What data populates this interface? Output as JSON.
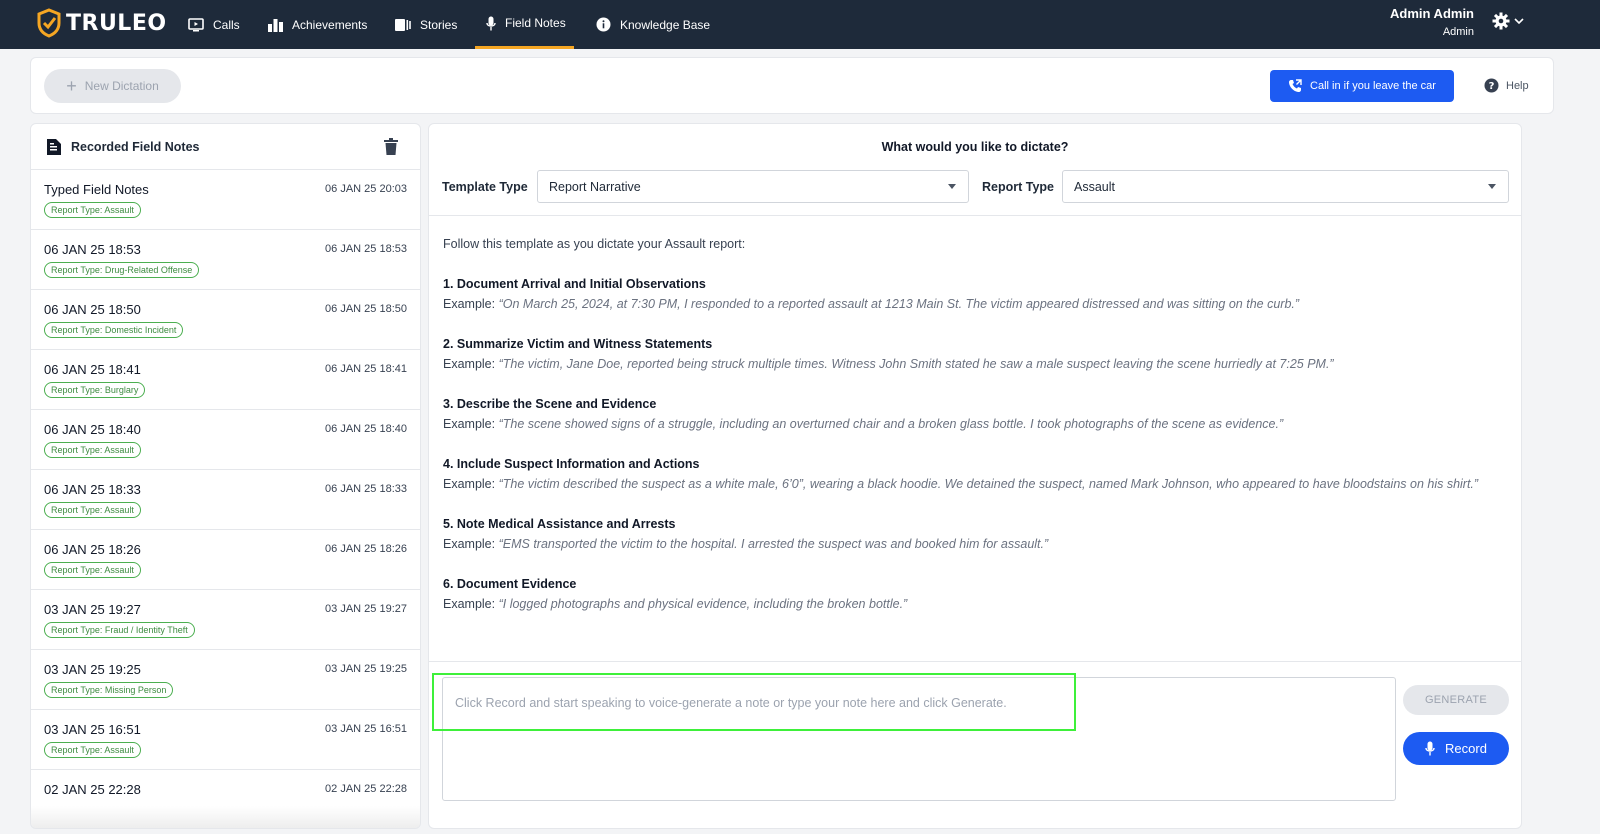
{
  "app": {
    "logo_text": "TRULEO",
    "accent": "#f5a623",
    "primary": "#1d5bf2"
  },
  "nav": {
    "items": [
      {
        "label": "Calls",
        "icon": "tv-play-icon"
      },
      {
        "label": "Achievements",
        "icon": "bar-chart-icon"
      },
      {
        "label": "Stories",
        "icon": "stories-icon"
      },
      {
        "label": "Field Notes",
        "icon": "microphone-icon",
        "active": true
      },
      {
        "label": "Knowledge Base",
        "icon": "info-icon"
      }
    ],
    "user": {
      "name": "Admin Admin",
      "role": "Admin"
    }
  },
  "toolbar": {
    "new_dictation": "New Dictation",
    "call_in": "Call in if you leave the car",
    "help": "Help"
  },
  "left": {
    "title": "Recorded Field Notes",
    "items": [
      {
        "title": "Typed Field Notes",
        "time": "06 JAN 25 20:03",
        "badge": "Report Type: Assault"
      },
      {
        "title": "06 JAN 25 18:53",
        "time": "06 JAN 25 18:53",
        "badge": "Report Type: Drug-Related Offense"
      },
      {
        "title": "06 JAN 25 18:50",
        "time": "06 JAN 25 18:50",
        "badge": "Report Type: Domestic Incident"
      },
      {
        "title": "06 JAN 25 18:41",
        "time": "06 JAN 25 18:41",
        "badge": "Report Type: Burglary"
      },
      {
        "title": "06 JAN 25 18:40",
        "time": "06 JAN 25 18:40",
        "badge": "Report Type: Assault"
      },
      {
        "title": "06 JAN 25 18:33",
        "time": "06 JAN 25 18:33",
        "badge": "Report Type: Assault"
      },
      {
        "title": "06 JAN 25 18:26",
        "time": "06 JAN 25 18:26",
        "badge": "Report Type: Assault"
      },
      {
        "title": "03 JAN 25 19:27",
        "time": "03 JAN 25 19:27",
        "badge": "Report Type: Fraud / Identity Theft"
      },
      {
        "title": "03 JAN 25 19:25",
        "time": "03 JAN 25 19:25",
        "badge": "Report Type: Missing Person"
      },
      {
        "title": "03 JAN 25 16:51",
        "time": "03 JAN 25 16:51",
        "badge": "Report Type: Assault"
      },
      {
        "title": "02 JAN 25 22:28",
        "time": "02 JAN 25 22:28",
        "badge": ""
      }
    ]
  },
  "right": {
    "question": "What would you like to dictate?",
    "template_label": "Template Type",
    "template_value": "Report Narrative",
    "report_label": "Report Type",
    "report_value": "Assault",
    "intro": "Follow this template as you dictate your Assault report:",
    "example_label": "Example:",
    "steps": [
      {
        "title": "1. Document Arrival and Initial Observations",
        "example": "“On March 25, 2024, at 7:30 PM, I responded to a reported assault at 1213 Main St. The victim appeared distressed and was sitting on the curb.”"
      },
      {
        "title": "2. Summarize Victim and Witness Statements",
        "example": "“The victim, Jane Doe, reported being struck multiple times. Witness John Smith stated he saw a male suspect leaving the scene hurriedly at 7:25 PM.”"
      },
      {
        "title": "3. Describe the Scene and Evidence",
        "example": "“The scene showed signs of a struggle, including an overturned chair and a broken glass bottle. I took photographs of the scene as evidence.”"
      },
      {
        "title": "4. Include Suspect Information and Actions",
        "example": "“The victim described the suspect as a white male, 6’0”, wearing a black hoodie. We detained the suspect, named Mark Johnson, who appeared to have bloodstains on his shirt.”"
      },
      {
        "title": "5. Note Medical Assistance and Arrests",
        "example": "“EMS transported the victim to the hospital. I arrested the suspect was and booked him for assault.”"
      },
      {
        "title": "6. Document Evidence",
        "example": "“I logged photographs and physical evidence, including the broken bottle.”"
      }
    ],
    "note_placeholder": "Click Record and start speaking to voice-generate a note or type your note here and click Generate.",
    "generate_label": "GENERATE",
    "record_label": "Record"
  }
}
